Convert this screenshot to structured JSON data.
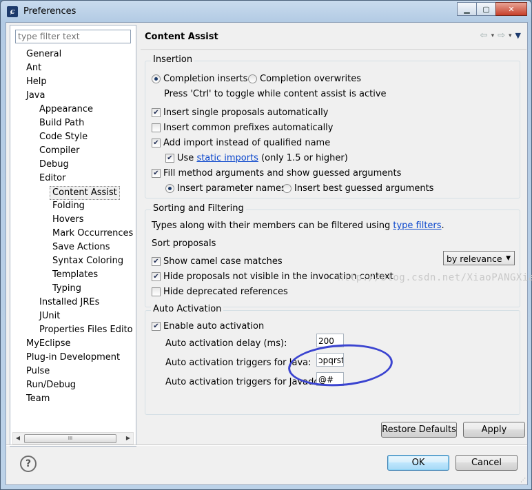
{
  "window": {
    "title": "Preferences",
    "controls": {
      "minimize": "▁",
      "maximize": "▢",
      "close": "✕"
    }
  },
  "filter": {
    "placeholder": "type filter text"
  },
  "tree": [
    {
      "label": "General",
      "level": 0
    },
    {
      "label": "Ant",
      "level": 0
    },
    {
      "label": "Help",
      "level": 0
    },
    {
      "label": "Java",
      "level": 0
    },
    {
      "label": "Appearance",
      "level": 1
    },
    {
      "label": "Build Path",
      "level": 1
    },
    {
      "label": "Code Style",
      "level": 1
    },
    {
      "label": "Compiler",
      "level": 1
    },
    {
      "label": "Debug",
      "level": 1
    },
    {
      "label": "Editor",
      "level": 1
    },
    {
      "label": "Content Assist",
      "level": 2,
      "selected": true
    },
    {
      "label": "Folding",
      "level": 2
    },
    {
      "label": "Hovers",
      "level": 2
    },
    {
      "label": "Mark Occurrences",
      "level": 2
    },
    {
      "label": "Save Actions",
      "level": 2
    },
    {
      "label": "Syntax Coloring",
      "level": 2
    },
    {
      "label": "Templates",
      "level": 2
    },
    {
      "label": "Typing",
      "level": 2
    },
    {
      "label": "Installed JREs",
      "level": 1
    },
    {
      "label": "JUnit",
      "level": 1
    },
    {
      "label": "Properties Files Edito",
      "level": 1
    },
    {
      "label": "MyEclipse",
      "level": 0
    },
    {
      "label": "Plug-in Development",
      "level": 0
    },
    {
      "label": "Pulse",
      "level": 0
    },
    {
      "label": "Run/Debug",
      "level": 0
    },
    {
      "label": "Team",
      "level": 0
    }
  ],
  "scrollbar": {
    "left_arrow": "◀",
    "right_arrow": "▶",
    "thumb_grip": "III"
  },
  "page": {
    "title": "Content Assist",
    "nav": {
      "back": "⇦",
      "forward": "⇨",
      "dropdown": "▾",
      "menu": "▼"
    }
  },
  "insertion": {
    "label": "Insertion",
    "completion_inserts": "Completion inserts",
    "completion_overwrites": "Completion overwrites",
    "toggle_hint": "Press 'Ctrl' to toggle while content assist is active",
    "insert_single": "Insert single proposals automatically",
    "insert_common": "Insert common prefixes automatically",
    "add_import": "Add import instead of qualified name",
    "use_label": "Use",
    "static_imports_link": "static imports",
    "use_suffix": "(only 1.5 or higher)",
    "fill_method": "Fill method arguments and show guessed arguments",
    "insert_param_names": "Insert parameter names",
    "insert_best_guessed": "Insert best guessed arguments"
  },
  "sorting": {
    "label": "Sorting and Filtering",
    "types_text": "Types along with their members can be filtered using",
    "type_filters_link": "type filters",
    "period": ".",
    "sort_label": "Sort proposals",
    "sort_value": "by relevance",
    "show_camel": "Show camel case matches",
    "hide_not_visible": "Hide proposals not visible in the invocation context",
    "hide_deprecated": "Hide deprecated references"
  },
  "auto": {
    "label": "Auto Activation",
    "enable": "Enable auto activation",
    "delay_label": "Auto activation delay (ms):",
    "delay_value": "200",
    "java_label": "Auto activation triggers for Java:",
    "java_value": "ɔpqrst",
    "javadoc_label": "Auto activation triggers for Javadoc:",
    "javadoc_value": "@#"
  },
  "watermark": "http://blog.csdn.net/XiaoPANGXia",
  "buttons": {
    "restore_defaults": "Restore Defaults",
    "apply": "Apply",
    "ok": "OK",
    "cancel": "Cancel",
    "help": "?"
  },
  "checks": {
    "checked": "✔"
  },
  "colors": {
    "link": "#0a46cc",
    "annotation_circle": "#3b44d0"
  }
}
